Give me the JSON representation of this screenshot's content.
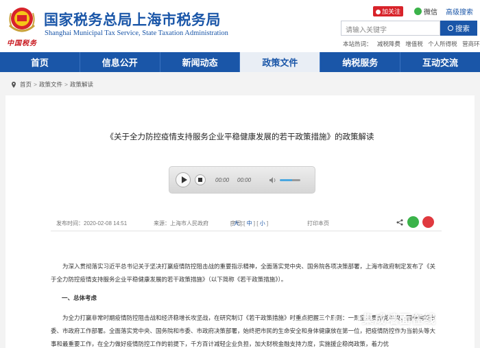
{
  "header": {
    "title_cn": "国家税务总局上海市税务局",
    "title_en": "Shanghai Municipal Tax Service, State Taxation Administration",
    "top_links": {
      "weibo": "加关注",
      "wechat": "微信",
      "old_site": "高级搜索"
    },
    "search": {
      "placeholder": "请输入关键字",
      "button": "搜索"
    },
    "hot_words": [
      "本站热词：",
      "减税降费",
      "增值税",
      "个人所得税",
      "营商环境"
    ]
  },
  "nav": {
    "items": [
      "首页",
      "信息公开",
      "新闻动态",
      "政策文件",
      "纳税服务",
      "互动交流"
    ],
    "active": 3
  },
  "breadcrumb": [
    "首页",
    "政策文件",
    "政策解读"
  ],
  "article": {
    "title": "《关于全力防控疫情支持服务企业平稳健康发展的若干政策措施》的政策解读",
    "player": {
      "current": "00:00",
      "total": "00:00",
      "volume": 0.6
    },
    "meta": {
      "date": "发布时间：2020-02-08 14:51",
      "source": "来源：上海市人民政府",
      "fontsize_label": "字号：",
      "sizes": [
        "大",
        "中",
        "小"
      ],
      "print": "打印本页"
    },
    "para1": "为深入贯彻落实习近平总书记关于坚决打赢疫情防控阻击战的重要指示精神，全面落实党中央、国务院各项决策部署，上海市政府制定发布了《关于全力防控疫情支持服务企业平稳健康发展的若干政策措施》（以下简称《若干政策措施》）。",
    "heading1": "一、总体考虑",
    "para2": "为全力打赢非常时期疫情防控阻击战和经济稳增长攻坚战，在研究制订《若干政策措施》时重点把握三个原则：一是坚决贯彻党中央、国务院和市委、市政府工作部署。全面落实党中央、国务院和市委、市政府决策部署，始终把市民的生命安全和身体健康放在第一位，把疫情防控作为当前头等大事和最重要工作，在全力做好疫情防控工作的前提下，千方百计减轻企业负担，加大财税金融支持力度，实施援企稳岗政策，着力优"
  },
  "watermark": "集成墙面在线",
  "colors": {
    "brand_blue": "#1a56a8",
    "weibo_red": "#d8232a",
    "wechat_green": "#3bb34a"
  }
}
